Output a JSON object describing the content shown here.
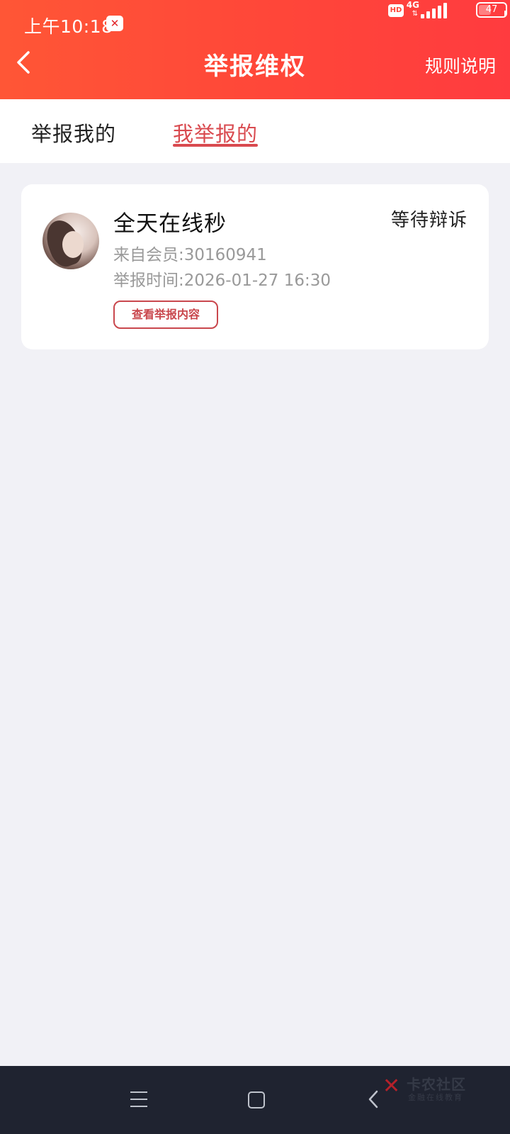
{
  "status_bar": {
    "time": "上午10:18",
    "network": "4G",
    "battery": "47",
    "battery_level": 0.47
  },
  "header": {
    "title": "举报维权",
    "rules_link": "规则说明"
  },
  "tabs": [
    {
      "label": "举报我的",
      "active": false
    },
    {
      "label": "我举报的",
      "active": true
    }
  ],
  "reports": [
    {
      "name": "全天在线秒",
      "status": "等待辩诉",
      "member": "来自会员:30160941",
      "report_time": "举报时间:2026-01-27 16:30",
      "action_label": "查看举报内容"
    }
  ],
  "watermark": {
    "title": "卡农社区",
    "subtitle": "金融在线教育"
  },
  "colors": {
    "header_start": "#ff5636",
    "header_end": "#ff3b3f",
    "accent": "#d94a4f",
    "background": "#f1f1f6",
    "nav_bar": "#1f2330"
  }
}
